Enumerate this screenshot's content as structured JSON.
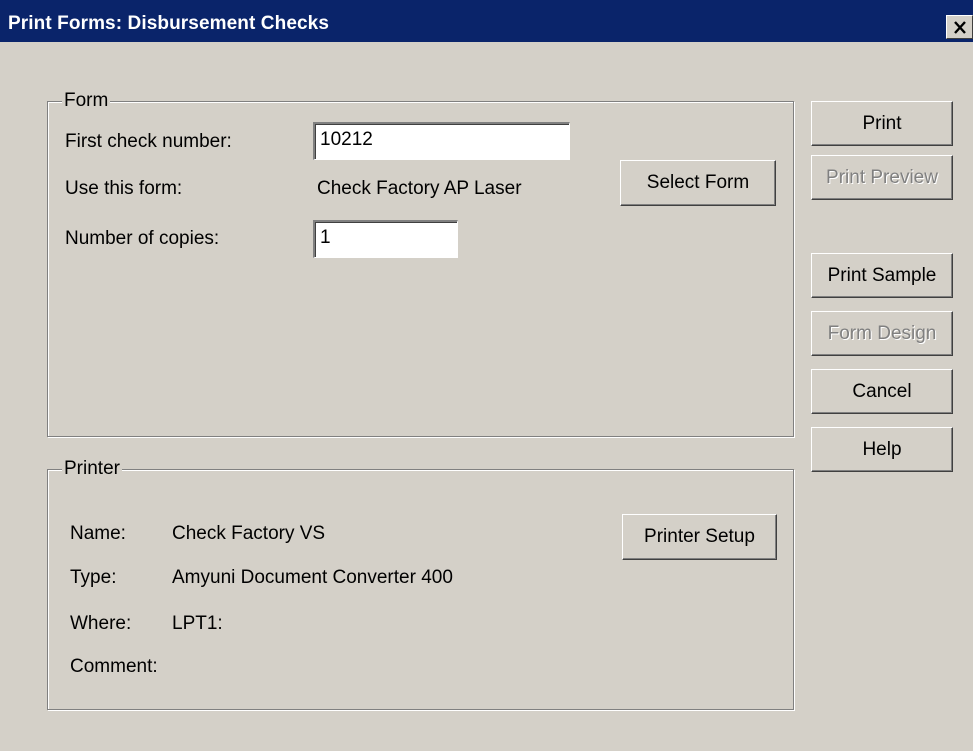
{
  "window": {
    "title": "Print Forms: Disbursement Checks",
    "close_icon": "close-icon"
  },
  "form_group": {
    "legend": "Form",
    "first_check_label": "First check number:",
    "first_check_value": "10212",
    "use_form_label": "Use this form:",
    "use_form_value": "Check Factory AP Laser",
    "copies_label": "Number of copies:",
    "copies_value": "1",
    "select_form_button": "Select Form"
  },
  "printer_group": {
    "legend": "Printer",
    "name_label": "Name:",
    "name_value": "Check Factory VS",
    "type_label": "Type:",
    "type_value": "Amyuni Document Converter 400",
    "where_label": "Where:",
    "where_value": "LPT1:",
    "comment_label": "Comment:",
    "comment_value": "",
    "printer_setup_button": "Printer Setup"
  },
  "actions": {
    "print": "Print",
    "print_preview": "Print Preview",
    "print_sample": "Print Sample",
    "form_design": "Form Design",
    "cancel": "Cancel",
    "help": "Help"
  },
  "colors": {
    "titlebar": "#0a246a",
    "face": "#d4d0c8",
    "disabled_text": "#808080"
  }
}
